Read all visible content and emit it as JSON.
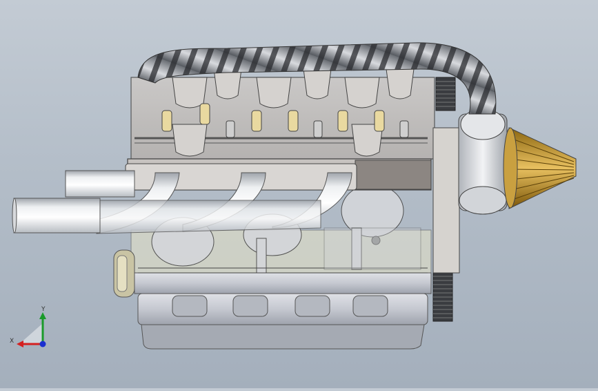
{
  "viewport": {
    "background_top": "#c3cbd4",
    "background_bottom": "#a4afbc",
    "model_parts": [
      "intake-hose",
      "cylinder-head",
      "valve-cover",
      "rocker-arms",
      "exhaust-header",
      "exhaust-pipe-upper",
      "exhaust-pipe-lower",
      "engine-block",
      "oil-pan",
      "turbocharger",
      "air-filter",
      "timing-pulley",
      "flywheel",
      "front-pulley",
      "pistons",
      "crankshaft"
    ]
  },
  "triad": {
    "x_label": "X",
    "y_label": "Y",
    "x_color": "#d42020",
    "y_color": "#1a9a2a",
    "z_color": "#1b2fd0"
  }
}
